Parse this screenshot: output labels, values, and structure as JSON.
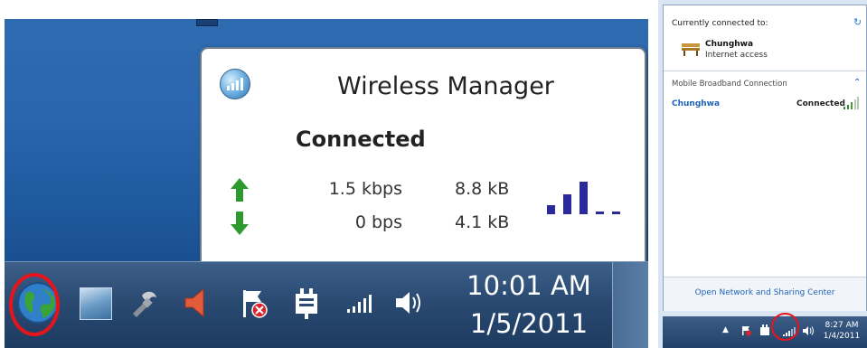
{
  "wireless_manager": {
    "title": "Wireless Manager",
    "status": "Connected",
    "upload_rate": "1.5 kbps",
    "upload_total": "8.8 kB",
    "download_rate": "0 bps",
    "download_total": "4.1 kB",
    "signal_bars_level": 3,
    "signal_bars_total": 5
  },
  "taskbar": {
    "tray_icons": [
      "globe-icon",
      "landscape-icon",
      "tool-icon",
      "speaker-red-icon",
      "action-center-flag-icon",
      "network-plug-icon",
      "signal-icon",
      "volume-icon"
    ],
    "clock_time": "10:01 AM",
    "clock_date": "1/5/2011"
  },
  "network_flyout": {
    "connected_to_label": "Currently connected to:",
    "network_name": "Chunghwa",
    "network_access": "Internet access",
    "section_header": "Mobile Broadband Connection",
    "connection": {
      "name": "Chunghwa",
      "status": "Connected"
    },
    "footer_link": "Open Network and Sharing Center"
  },
  "mini_taskbar": {
    "clock_time": "8:27 AM",
    "clock_date": "1/4/2011"
  },
  "colors": {
    "highlight_circle": "#e8141c",
    "signal_bar": "#2a2a9c",
    "upload_arrow": "#2e9a2e",
    "link_blue": "#1e63b8"
  }
}
